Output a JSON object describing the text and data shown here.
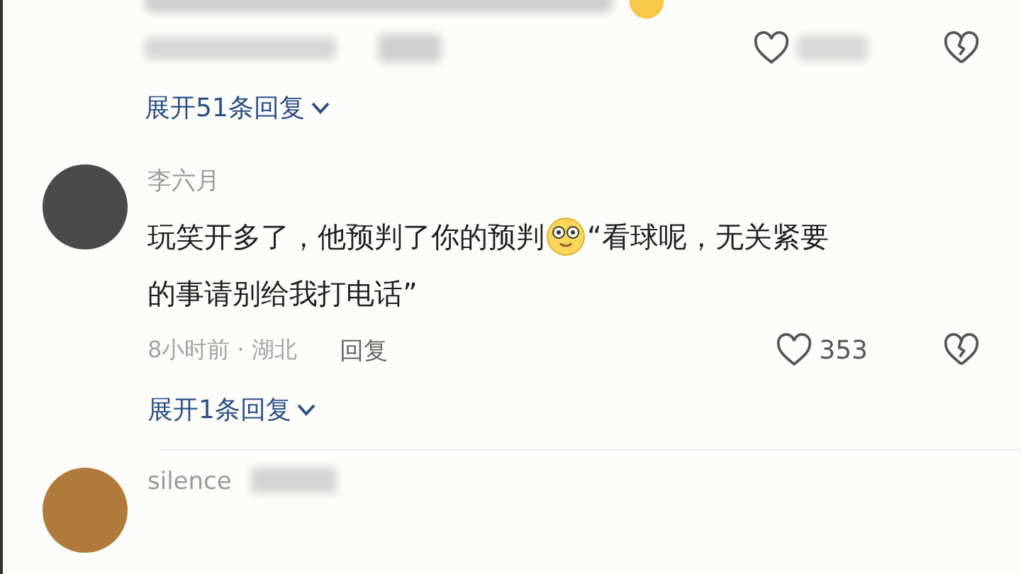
{
  "comments": [
    {
      "kind": "blurred",
      "expand_label": "展开51条回复"
    },
    {
      "kind": "full",
      "author": "李六月",
      "text_before": "玩笑开多了，他预判了你的预判",
      "text_after": "“看球呢，无关紧要",
      "text_line2": "的事请别给我打电话”",
      "meta": "8小时前 · 湖北",
      "reply_label": "回复",
      "like_count": "353",
      "expand_label": "展开1条回复"
    },
    {
      "kind": "cut",
      "author": "silence"
    }
  ]
}
